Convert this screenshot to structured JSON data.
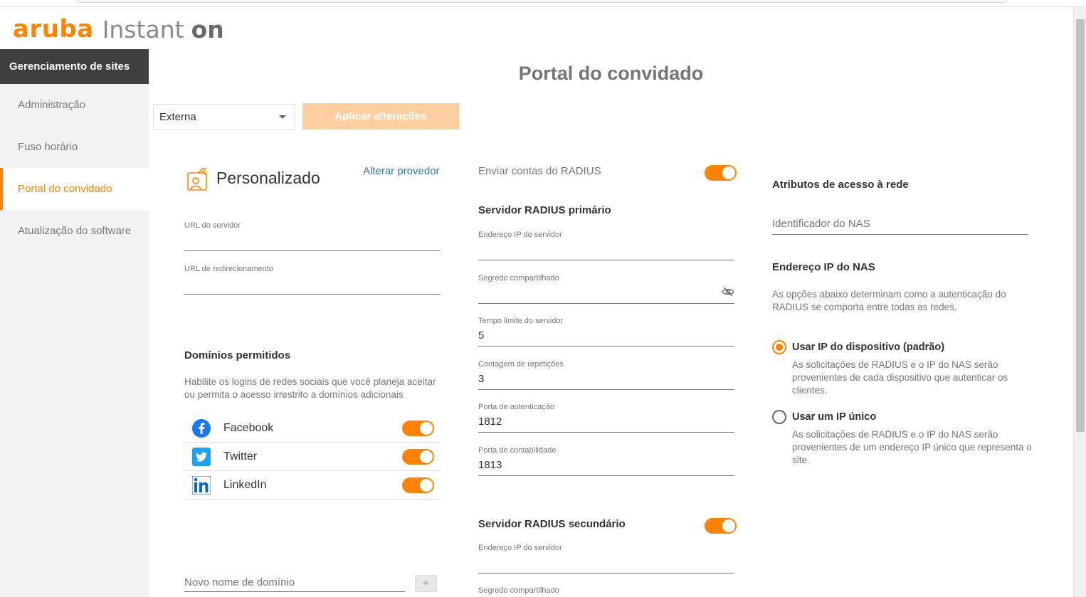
{
  "brand": {
    "name": "aruba",
    "product": "Instant",
    "on": "on"
  },
  "sidebar": {
    "header": "Gerenciamento de sites",
    "items": [
      {
        "label": "Administração"
      },
      {
        "label": "Fuso horário"
      },
      {
        "label": "Portal do convidado"
      },
      {
        "label": "Atualização do software"
      }
    ]
  },
  "page": {
    "title": "Portal do convidado"
  },
  "toolbar": {
    "portal_type": "Externa",
    "apply_label": "Aplicar alterações"
  },
  "provider": {
    "name": "Personalizado",
    "change_label": "Alterar provedor",
    "server_url_label": "URL do servidor",
    "server_url_value": "",
    "redirect_url_label": "URL de redirecionamento",
    "redirect_url_value": ""
  },
  "domains": {
    "title": "Domínios permitidos",
    "description": "Habilite os logins de redes sociais que você planeja aceitar ou permita o acesso irrestrito a domínios adicionais",
    "social": [
      {
        "name": "Facebook",
        "enabled": true
      },
      {
        "name": "Twitter",
        "enabled": true
      },
      {
        "name": "LinkedIn",
        "enabled": true
      }
    ],
    "new_domain_placeholder": "Novo nome de domínio",
    "add_symbol": "+"
  },
  "radius": {
    "send_accounts_label": "Enviar contas do RADIUS",
    "send_accounts_enabled": true,
    "primary": {
      "title": "Servidor RADIUS primário",
      "ip_label": "Endereço IP do servidor",
      "ip_value": "",
      "secret_label": "Segredo compartilhado",
      "secret_value": "",
      "timeout_label": "Tempo limite do servidor",
      "timeout_value": "5",
      "retries_label": "Contagem de repetições",
      "retries_value": "3",
      "auth_port_label": "Porta de autenticação",
      "auth_port_value": "1812",
      "acct_port_label": "Porta de contabilidade",
      "acct_port_value": "1813"
    },
    "secondary": {
      "title": "Servidor RADIUS secundário",
      "enabled": true,
      "ip_label": "Endereço IP do servidor",
      "ip_value": "",
      "secret_label": "Segredo compartilhado"
    }
  },
  "network_access": {
    "title": "Atributos de acesso à rede",
    "nas_id_placeholder": "Identificador do NAS",
    "nas_ip_title": "Endereço IP do NAS",
    "nas_ip_description": "As opções abaixo determinam como a autenticação do RADIUS se comporta entre todas as redes.",
    "options": [
      {
        "label": "Usar IP do dispositivo (padrão)",
        "description": "As solicitações de RADIUS e o IP do NAS serão provenientes de cada dispositivo que autenticar os clientes.",
        "selected": true
      },
      {
        "label": "Usar um IP único",
        "description": "As solicitações de RADIUS e o IP do NAS serão provenientes de um endereço IP único que representa o site.",
        "selected": false
      }
    ]
  },
  "colors": {
    "accent": "#ff8300",
    "link": "#2f76b7",
    "sidebar_header": "#3f3f3f"
  }
}
